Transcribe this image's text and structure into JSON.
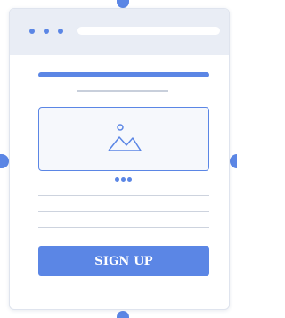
{
  "colors": {
    "accent": "#5b86e5",
    "titlebar": "#e9edf5",
    "line": "#cdd3de",
    "frame_border": "#dfe4ee"
  },
  "window": {
    "titlebar_dots": [
      "dot",
      "dot",
      "dot"
    ],
    "address_bar_icon": "address-bar"
  },
  "content": {
    "image_placeholder_icon": "image-icon",
    "carousel_dots": 3,
    "text_lines": 3
  },
  "signup_button": {
    "label": "SIGN UP"
  }
}
